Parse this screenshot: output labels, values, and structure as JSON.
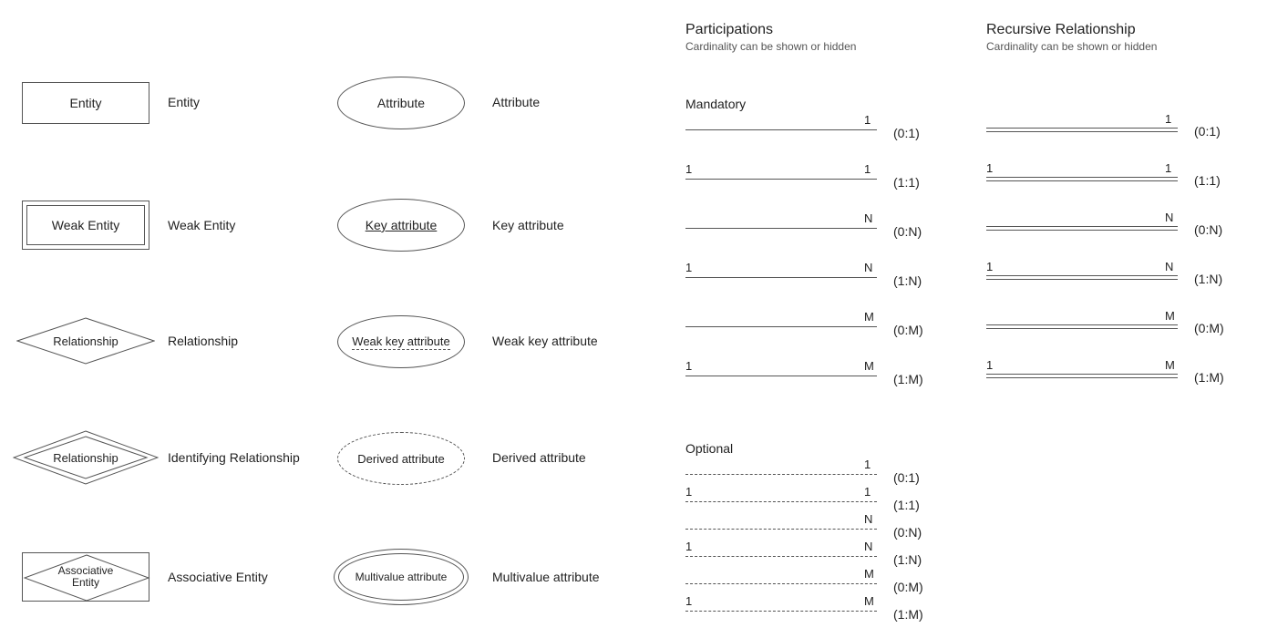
{
  "shapes": {
    "entity": {
      "symbol": "Entity",
      "label": "Entity"
    },
    "weak_entity": {
      "symbol": "Weak Entity",
      "label": "Weak Entity"
    },
    "relationship": {
      "symbol": "Relationship",
      "label": "Relationship"
    },
    "id_relationship": {
      "symbol": "Relationship",
      "label": "Identifying Relationship"
    },
    "assoc_entity": {
      "symbol_line1": "Associative",
      "symbol_line2": "Entity",
      "label": "Associative Entity"
    },
    "attribute": {
      "symbol": "Attribute",
      "label": "Attribute"
    },
    "key_attr": {
      "symbol": "Key attribute",
      "label": "Key attribute"
    },
    "weak_key_attr": {
      "symbol": "Weak key attribute",
      "label": "Weak key attribute"
    },
    "derived_attr": {
      "symbol": "Derived attribute",
      "label": "Derived attribute"
    },
    "multi_attr": {
      "symbol": "Multivalue attribute",
      "label": "Multivalue attribute"
    }
  },
  "participations_title": "Participations",
  "recursive_title": "Recursive Relationship",
  "subtitle": "Cardinality can be shown or hidden",
  "mandatory_label": "Mandatory",
  "optional_label": "Optional",
  "participations": {
    "mandatory": [
      {
        "left": "",
        "right": "1",
        "caption": "(0:1)"
      },
      {
        "left": "1",
        "right": "1",
        "caption": "(1:1)"
      },
      {
        "left": "",
        "right": "N",
        "caption": "(0:N)"
      },
      {
        "left": "1",
        "right": "N",
        "caption": "(1:N)"
      },
      {
        "left": "",
        "right": "M",
        "caption": "(0:M)"
      },
      {
        "left": "1",
        "right": "M",
        "caption": "(1:M)"
      }
    ],
    "optional": [
      {
        "left": "",
        "right": "1",
        "caption": "(0:1)"
      },
      {
        "left": "1",
        "right": "1",
        "caption": "(1:1)"
      },
      {
        "left": "",
        "right": "N",
        "caption": "(0:N)"
      },
      {
        "left": "1",
        "right": "N",
        "caption": "(1:N)"
      },
      {
        "left": "",
        "right": "M",
        "caption": "(0:M)"
      },
      {
        "left": "1",
        "right": "M",
        "caption": "(1:M)"
      }
    ]
  },
  "recursive": [
    {
      "left": "",
      "right": "1",
      "caption": "(0:1)"
    },
    {
      "left": "1",
      "right": "1",
      "caption": "(1:1)"
    },
    {
      "left": "",
      "right": "N",
      "caption": "(0:N)"
    },
    {
      "left": "1",
      "right": "N",
      "caption": "(1:N)"
    },
    {
      "left": "",
      "right": "M",
      "caption": "(0:M)"
    },
    {
      "left": "1",
      "right": "M",
      "caption": "(1:M)"
    }
  ]
}
